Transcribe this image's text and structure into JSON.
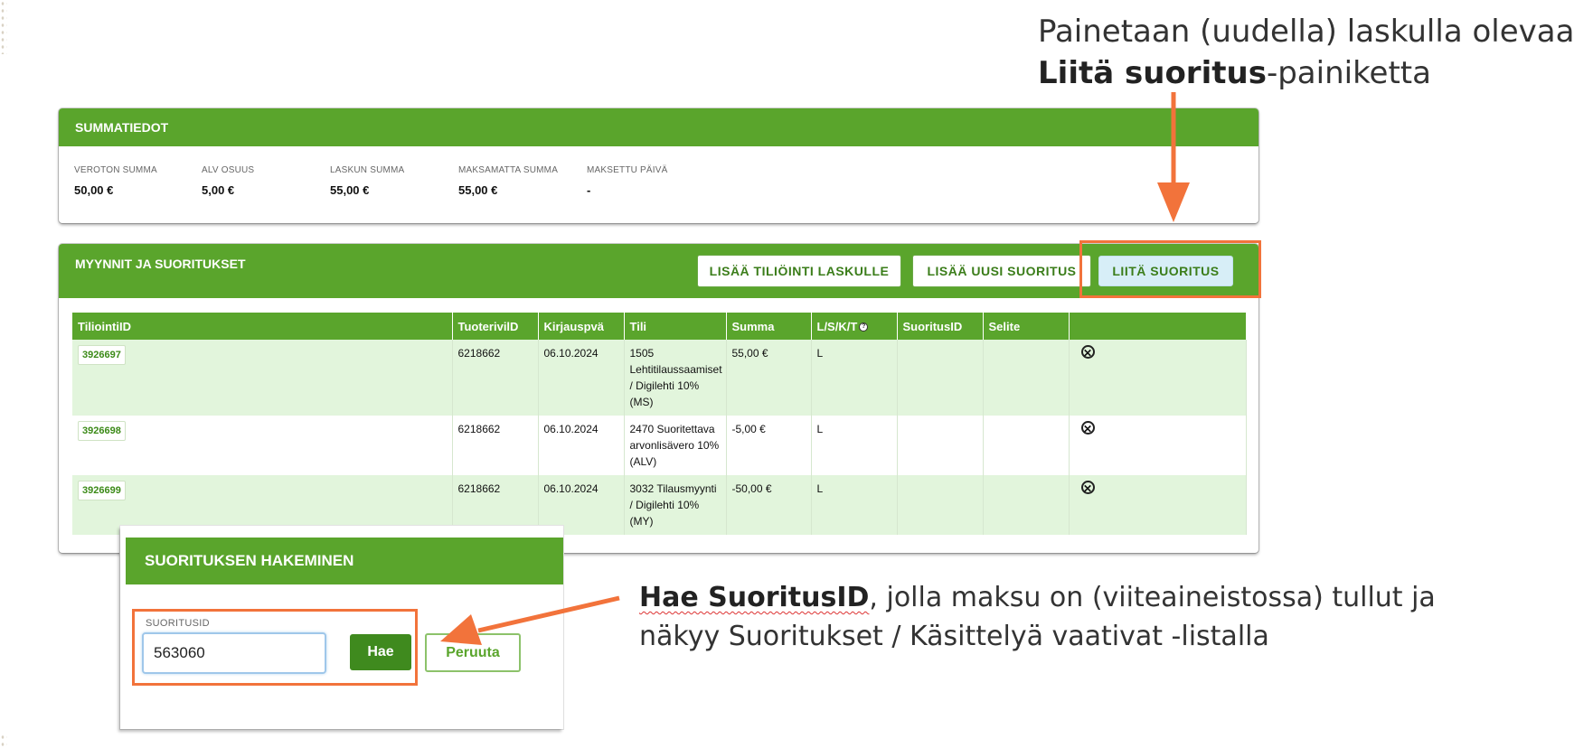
{
  "callouts": {
    "top_line1": "Painetaan (uudella) laskulla olevaa",
    "top_bold": "Liitä suoritus",
    "top_rest": "-painiketta",
    "bottom_bold": "Hae SuoritusID",
    "bottom_rest1": ", jolla maksu on (viiteaineistossa) tullut ja",
    "bottom_line2": "näkyy Suoritukset / Käsittelyä vaativat -listalla"
  },
  "summary": {
    "title": "SUMMATIEDOT",
    "items": [
      {
        "label": "VEROTON SUMMA",
        "value": "50,00 €"
      },
      {
        "label": "ALV OSUUS",
        "value": "5,00 €"
      },
      {
        "label": "LASKUN SUMMA",
        "value": "55,00 €"
      },
      {
        "label": "MAKSAMATTA SUMMA",
        "value": "55,00 €"
      },
      {
        "label": "MAKSETTU PÄIVÄ",
        "value": "-"
      }
    ]
  },
  "sales": {
    "title": "MYYNNIT JA SUORITUKSET",
    "buttons": {
      "add_entry": "LISÄÄ TILIÖINTI LASKULLE",
      "add_payment": "LISÄÄ UUSI SUORITUS",
      "attach_payment": "LIITÄ SUORITUS"
    },
    "columns": [
      "TiliointiID",
      "TuoterivilD",
      "Kirjauspvä",
      "Tili",
      "Summa",
      "L/S/K/T",
      "SuoritusID",
      "Selite",
      ""
    ],
    "rows": [
      {
        "id": "3926697",
        "row_id": "6218662",
        "date": "06.10.2024",
        "account": "1505 Lehtitilaussaamiset / Digilehti 10% (MS)",
        "amount": "55,00 €",
        "type": "L",
        "payment_id": "",
        "note": ""
      },
      {
        "id": "3926698",
        "row_id": "6218662",
        "date": "06.10.2024",
        "account": "2470 Suoritettava arvonlisävero 10% (ALV)",
        "amount": "-5,00 €",
        "type": "L",
        "payment_id": "",
        "note": ""
      },
      {
        "id": "3926699",
        "row_id": "6218662",
        "date": "06.10.2024",
        "account": "3032 Tilausmyynti / Digilehti 10% (MY)",
        "amount": "-50,00 €",
        "type": "L",
        "payment_id": "",
        "note": ""
      }
    ]
  },
  "search_dialog": {
    "title": "SUORITUKSEN HAKEMINEN",
    "field_label": "SUORITUSID",
    "field_value": "563060",
    "search_button": "Hae",
    "cancel_button": "Peruuta"
  },
  "colors": {
    "green": "#5aa52c",
    "dark_green": "#3f8a1e",
    "highlight_orange": "#f2733b",
    "row_tint": "#e2f5dc"
  },
  "icons": [
    "remove-icon",
    "info-icon",
    "arrow-down",
    "arrow-left"
  ]
}
